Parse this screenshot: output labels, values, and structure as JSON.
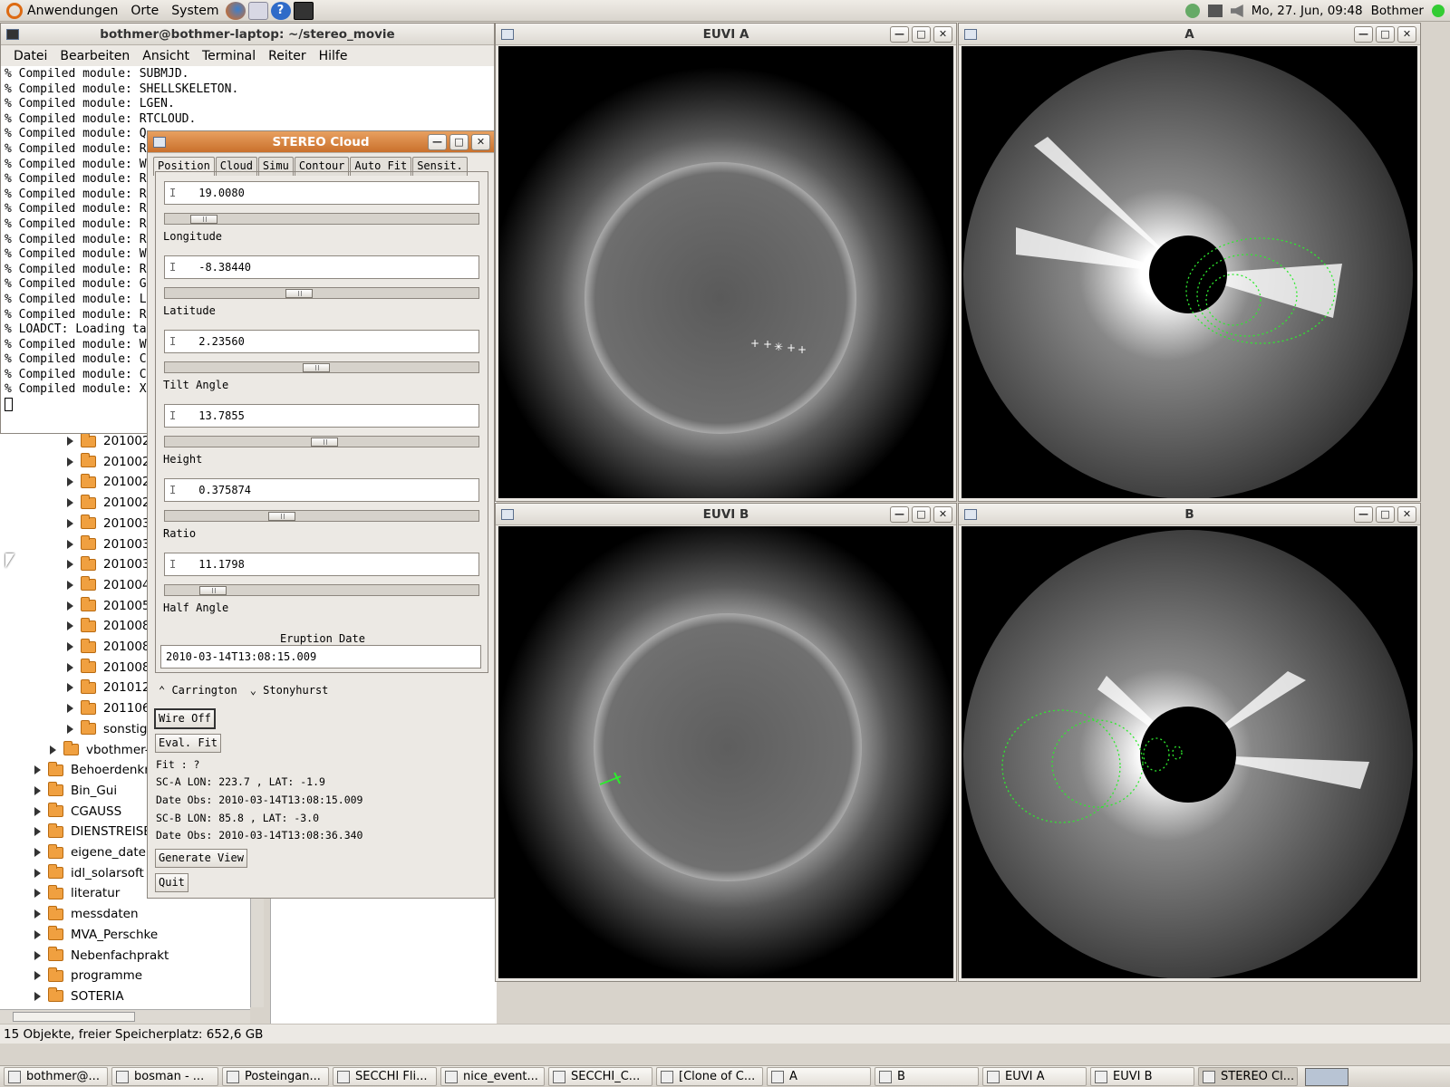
{
  "topbar": {
    "menus": [
      "Anwendungen",
      "Orte",
      "System"
    ],
    "clock": "Mo, 27. Jun, 09:48",
    "user": "Bothmer"
  },
  "terminal": {
    "title": "bothmer@bothmer-laptop: ~/stereo_movie",
    "menu": [
      "Datei",
      "Bearbeiten",
      "Ansicht",
      "Terminal",
      "Reiter",
      "Hilfe"
    ],
    "lines": [
      "% Compiled module: SUBMJD.",
      "% Compiled module: SHELLSKELETON.",
      "% Compiled module: LGEN.",
      "% Compiled module: RTCLOUD.",
      "% Compiled module: Q",
      "% Compiled module: R",
      "% Compiled module: W",
      "% Compiled module: R",
      "% Compiled module: R",
      "% Compiled module: R",
      "% Compiled module: R",
      "% Compiled module: R",
      "% Compiled module: W",
      "% Compiled module: R",
      "% Compiled module: G",
      "% Compiled module: L",
      "% Compiled module: R",
      "% LOADCT: Loading ta",
      "% Compiled module: W",
      "% Compiled module: C",
      "% Compiled module: C",
      "% Compiled module: X"
    ]
  },
  "filemanager": {
    "folders_sub": [
      "201002",
      "201002",
      "201002",
      "201002",
      "201003",
      "201003",
      "201003",
      "201004",
      "201005",
      "201008",
      "201008",
      "201008",
      "201012",
      "201106",
      "sonstige"
    ],
    "folders_mid": [
      "vbothmer-j"
    ],
    "folders_top": [
      "Behoerdenkra",
      "Bin_Gui",
      "CGAUSS",
      "DIENSTREISEN",
      "eigene_dateie",
      "idl_solarsoft",
      "literatur",
      "messdaten",
      "MVA_Perschke",
      "Nebenfachprakt",
      "programme",
      "SOTERIA"
    ],
    "status": "15 Objekte, freier Speicherplatz: 652,6 GB"
  },
  "stereo": {
    "title": "STEREO Cloud",
    "tabs": [
      "Position",
      "Cloud",
      "Simu",
      "Contour",
      "Auto Fit",
      "Sensit."
    ],
    "params": [
      {
        "label": "Longitude",
        "value": "19.0080",
        "pos": 0.09
      },
      {
        "label": "Latitude",
        "value": "-8.38440",
        "pos": 0.42
      },
      {
        "label": "Tilt Angle",
        "value": "2.23560",
        "pos": 0.48
      },
      {
        "label": "Height",
        "value": "13.7855",
        "pos": 0.51
      },
      {
        "label": "Ratio",
        "value": "0.375874",
        "pos": 0.36
      },
      {
        "label": "Half Angle",
        "value": "11.1798",
        "pos": 0.12
      }
    ],
    "eruption_label": "Eruption Date",
    "eruption_date": "2010-03-14T13:08:15.009",
    "radio": [
      "Carrington",
      "Stonyhurst"
    ],
    "wire_btn": "Wire Off",
    "eval_btn": "Eval. Fit",
    "fit": "Fit : ?",
    "sca": "SC-A LON:  223.7 , LAT:  -1.9",
    "date_a": "Date Obs: 2010-03-14T13:08:15.009",
    "scb": "SC-B LON:   85.8 , LAT:  -3.0",
    "date_b": "Date Obs: 2010-03-14T13:08:36.340",
    "gen_btn": "Generate View",
    "quit_btn": "Quit"
  },
  "image_windows": {
    "euvi_a": "EUVI A",
    "cor_a": "A",
    "euvi_b": "EUVI B",
    "cor_b": "B"
  },
  "taskbar": [
    "bothmer@...",
    "bosman - ...",
    "Posteingan...",
    "SECCHI Fli...",
    "nice_event...",
    "SECCHI_C...",
    "[Clone of C...",
    "A",
    "B",
    "EUVI A",
    "EUVI B",
    "STEREO Cl..."
  ]
}
